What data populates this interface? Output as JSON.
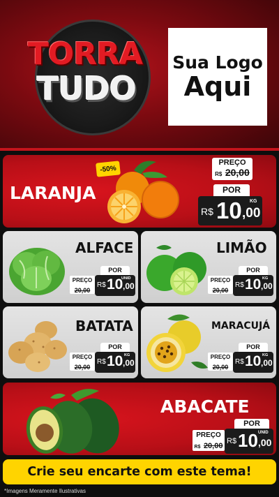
{
  "header": {
    "brand_line1": "TORRA",
    "brand_line2": "TUDO",
    "logo_line1": "Sua Logo",
    "logo_line2": "Aqui"
  },
  "products": {
    "laranja": {
      "name": "LARANJA",
      "discount": "-50%",
      "old_label": "PREÇO",
      "old_price": "20,00",
      "old_currency": "R$",
      "por": "POR",
      "currency": "R$",
      "price_int": "10",
      "price_dec": ",00",
      "unit": "KG",
      "image_icon": "orange-icon"
    },
    "alface": {
      "name": "ALFACE",
      "old_label": "PREÇO",
      "old_price": "20,00",
      "old_currency": "R$",
      "por": "POR",
      "currency": "R$",
      "price_int": "10",
      "price_dec": ",00",
      "unit": "UNID",
      "image_icon": "lettuce-icon"
    },
    "limao": {
      "name": "LIMÃO",
      "old_label": "PREÇO",
      "old_price": "20,00",
      "old_currency": "R$",
      "por": "POR",
      "currency": "R$",
      "price_int": "10",
      "price_dec": ",00",
      "unit": "KG",
      "image_icon": "lime-icon"
    },
    "batata": {
      "name": "BATATA",
      "old_label": "PREÇO",
      "old_price": "20,00",
      "old_currency": "R$",
      "por": "POR",
      "currency": "R$",
      "price_int": "10",
      "price_dec": ",00",
      "unit": "KG",
      "image_icon": "potato-icon"
    },
    "maracuja": {
      "name": "MARACUJÁ",
      "old_label": "PREÇO",
      "old_price": "20,00",
      "old_currency": "R$",
      "por": "POR",
      "currency": "R$",
      "price_int": "10",
      "price_dec": ",00",
      "unit": "KG",
      "image_icon": "passion-fruit-icon"
    },
    "abacate": {
      "name": "ABACATE",
      "old_label": "PREÇO",
      "old_price": "20,00",
      "old_currency": "R$",
      "por": "POR",
      "currency": "R$",
      "price_int": "10",
      "price_dec": ",00",
      "unit": "UNID",
      "image_icon": "avocado-icon"
    }
  },
  "footer": {
    "cta": "Crie seu encarte com este tema!",
    "disclaimer": "*Imagens Meramente Ilustrativas"
  },
  "colors": {
    "red": "#c4141c",
    "yellow": "#ffd400",
    "dark": "#1b1b1b"
  }
}
